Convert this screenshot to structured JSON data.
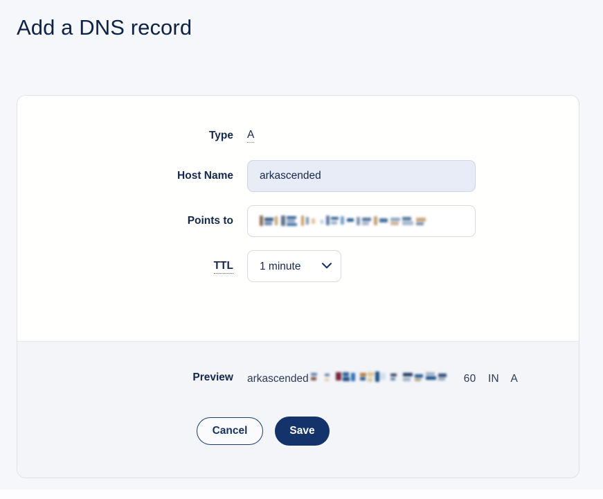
{
  "page": {
    "title": "Add a DNS record",
    "background_color": "#f6f7fb",
    "accent_color": "#15336b"
  },
  "form": {
    "fields": [
      {
        "label": "Type",
        "kind": "static-value",
        "value": "A",
        "has_hint_underline": true
      },
      {
        "label": "Host Name",
        "kind": "text-input",
        "value": "arkascended",
        "placeholder": "",
        "filled": true
      },
      {
        "label": "Points to",
        "kind": "text-input-redacted",
        "value": "",
        "placeholder": "",
        "redacted": true
      },
      {
        "label": "TTL",
        "kind": "select",
        "value": "1 minute",
        "has_hint_underline": true,
        "options": [
          "1 minute"
        ],
        "icon": "chevron-down-icon"
      }
    ]
  },
  "footer": {
    "preview": {
      "label": "Preview",
      "host": "arkascended",
      "domain_redacted": true,
      "ttl_seconds": "60",
      "record_class": "IN",
      "record_type": "A"
    },
    "buttons": {
      "cancel_label": "Cancel",
      "save_label": "Save"
    }
  }
}
